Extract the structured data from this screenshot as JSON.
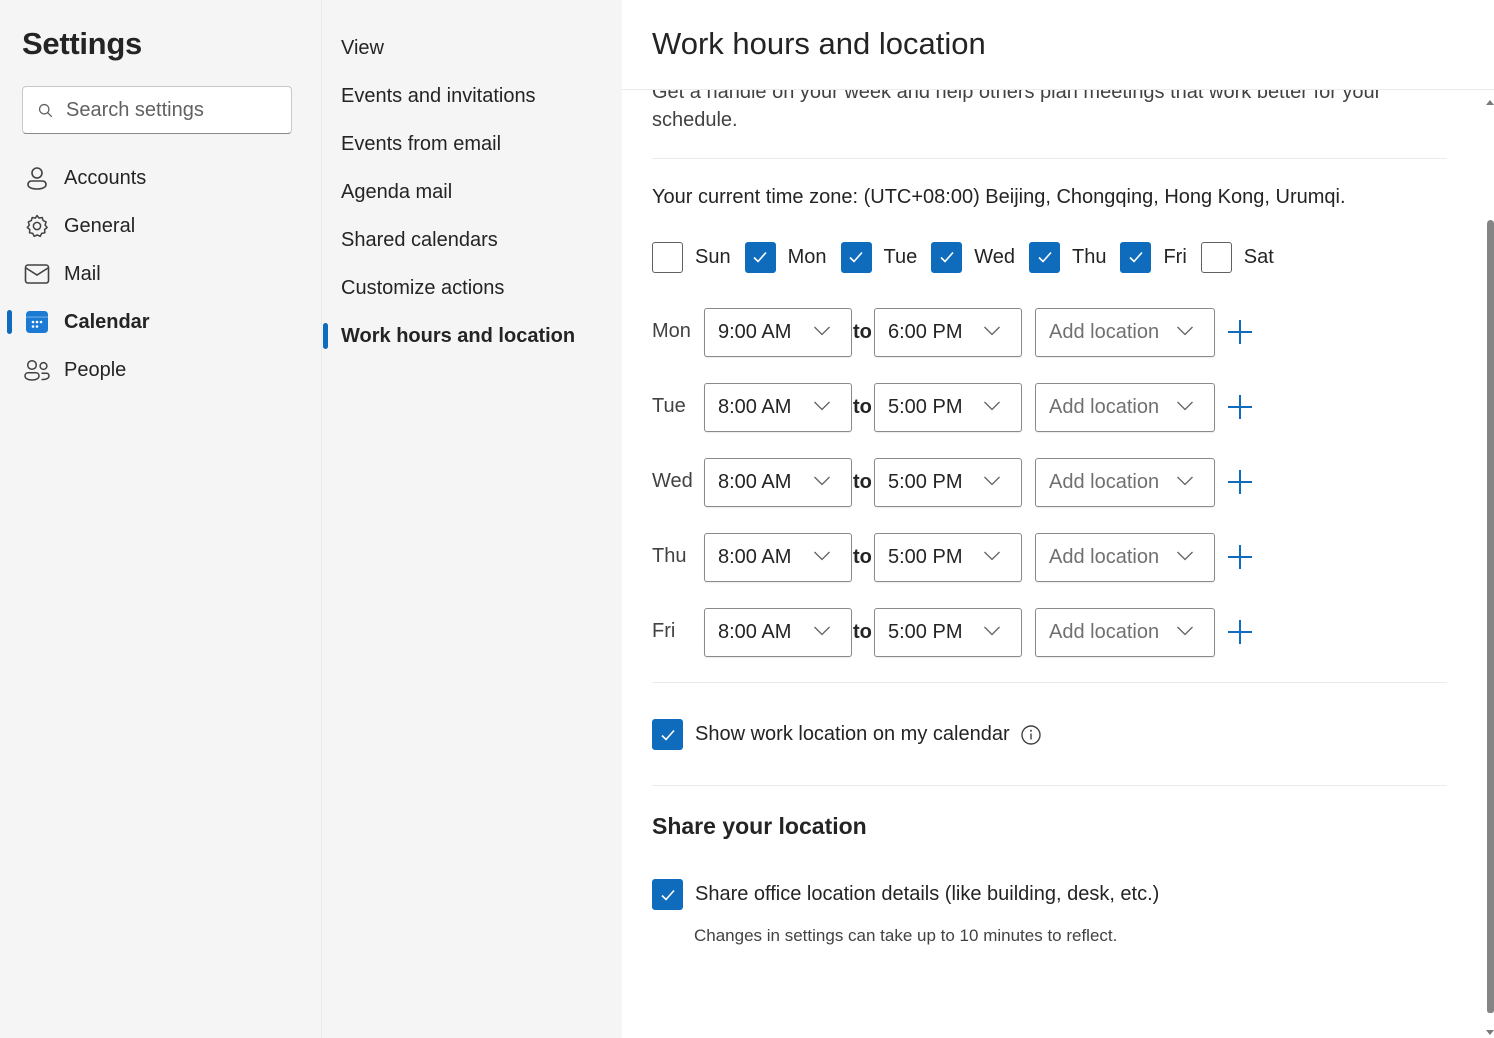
{
  "sidebar": {
    "title": "Settings",
    "search": {
      "placeholder": "Search settings",
      "value": ""
    },
    "items": [
      {
        "label": "Accounts",
        "icon": "person-icon",
        "active": false
      },
      {
        "label": "General",
        "icon": "gear-icon",
        "active": false
      },
      {
        "label": "Mail",
        "icon": "mail-icon",
        "active": false
      },
      {
        "label": "Calendar",
        "icon": "calendar-icon",
        "active": true
      },
      {
        "label": "People",
        "icon": "people-icon",
        "active": false
      }
    ]
  },
  "subnav": {
    "items": [
      {
        "label": "View",
        "active": false
      },
      {
        "label": "Events and invitations",
        "active": false
      },
      {
        "label": "Events from email",
        "active": false
      },
      {
        "label": "Agenda mail",
        "active": false
      },
      {
        "label": "Shared calendars",
        "active": false
      },
      {
        "label": "Customize actions",
        "active": false
      },
      {
        "label": "Work hours and location",
        "active": true
      }
    ]
  },
  "main": {
    "title": "Work hours and location",
    "description": "Get a handle on your week and help others plan meetings that work better for your schedule.",
    "timezone": "Your current time zone: (UTC+08:00) Beijing, Chongqing, Hong Kong, Urumqi.",
    "days": [
      {
        "label": "Sun",
        "checked": false
      },
      {
        "label": "Mon",
        "checked": true
      },
      {
        "label": "Tue",
        "checked": true
      },
      {
        "label": "Wed",
        "checked": true
      },
      {
        "label": "Thu",
        "checked": true
      },
      {
        "label": "Fri",
        "checked": true
      },
      {
        "label": "Sat",
        "checked": false
      }
    ],
    "to_label": "to",
    "location_placeholder": "Add location",
    "hours": [
      {
        "day": "Mon",
        "start": "9:00 AM",
        "end": "6:00 PM"
      },
      {
        "day": "Tue",
        "start": "8:00 AM",
        "end": "5:00 PM"
      },
      {
        "day": "Wed",
        "start": "8:00 AM",
        "end": "5:00 PM"
      },
      {
        "day": "Thu",
        "start": "8:00 AM",
        "end": "5:00 PM"
      },
      {
        "day": "Fri",
        "start": "8:00 AM",
        "end": "5:00 PM"
      }
    ],
    "show_location": {
      "label": "Show work location on my calendar",
      "checked": true
    },
    "share_section": {
      "title": "Share your location",
      "share_details": {
        "label": "Share office location details (like building, desk, etc.)",
        "checked": true
      },
      "note": "Changes in settings can take up to 10 minutes to reflect."
    }
  },
  "colors": {
    "accent": "#0f6cbd",
    "pane_background": "#f5f5f5"
  }
}
